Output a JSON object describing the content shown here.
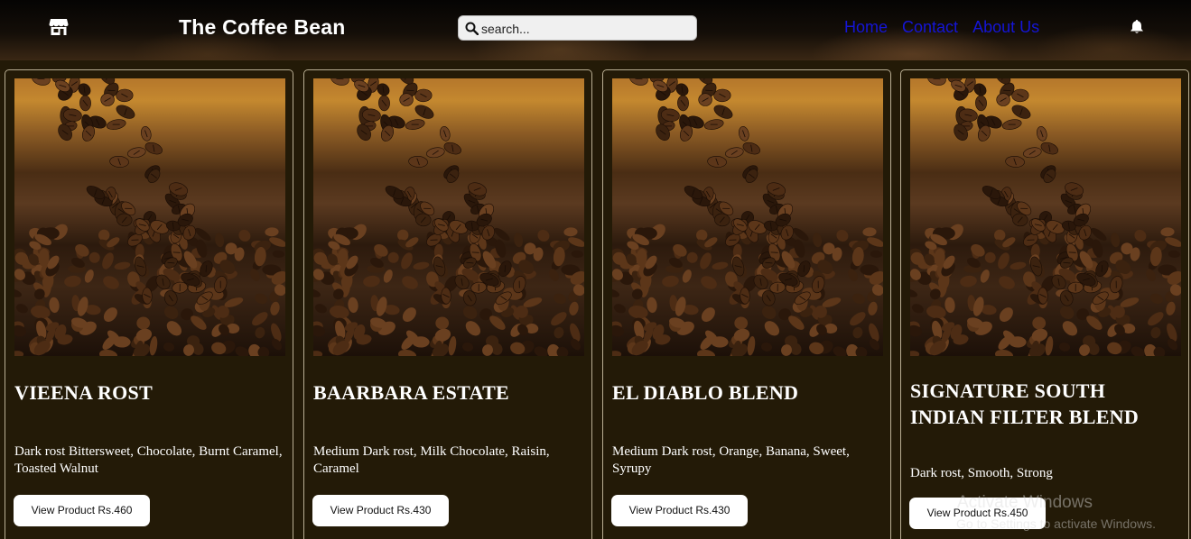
{
  "header": {
    "brand": "The Coffee Bean",
    "search_placeholder": "search...",
    "nav": [
      "Home",
      "Contact",
      "About Us"
    ],
    "icons": {
      "store": "store-icon",
      "search": "search-icon",
      "notifications": "bell-icon"
    }
  },
  "colors": {
    "background": "#231a07",
    "nav_link": "#1515d6",
    "card_border": "#b9ae93",
    "button_bg": "#ffffff"
  },
  "products": [
    {
      "name": "VIEENA ROST",
      "description": "Dark rost Bittersweet, Chocolate, Burnt Caramel, Toasted Walnut",
      "button": "View Product Rs.460"
    },
    {
      "name": "BAARBARA ESTATE",
      "description": "Medium Dark rost, Milk Chocolate, Raisin, Caramel",
      "button": "View Product Rs.430"
    },
    {
      "name": "EL DIABLO BLEND",
      "description": "Medium Dark rost, Orange, Banana, Sweet, Syrupy",
      "button": "View Product Rs.430"
    },
    {
      "name": "SIGNATURE SOUTH INDIAN FILTER BLEND",
      "description": "Dark rost, Smooth, Strong",
      "button": "View Product Rs.450"
    }
  ],
  "watermark": {
    "title": "Activate Windows",
    "subtitle": "Go to Settings to activate Windows."
  }
}
